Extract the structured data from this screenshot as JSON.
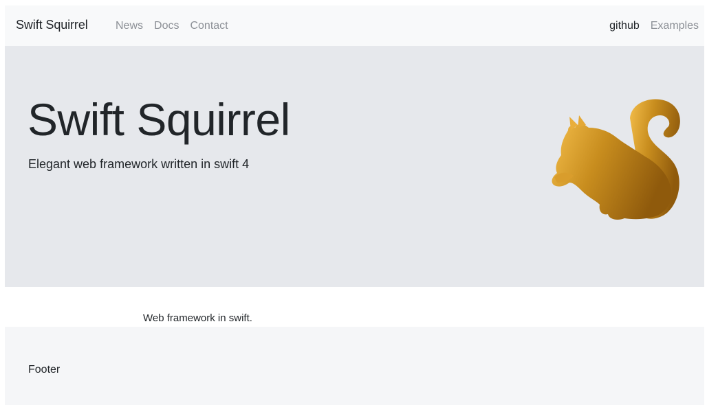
{
  "navbar": {
    "brand": "Swift Squirrel",
    "left_links": [
      {
        "label": "News",
        "active": false
      },
      {
        "label": "Docs",
        "active": false
      },
      {
        "label": "Contact",
        "active": false
      }
    ],
    "right_links": [
      {
        "label": "github",
        "active": true
      },
      {
        "label": "Examples",
        "active": false
      }
    ]
  },
  "hero": {
    "title": "Swift Squirrel",
    "lead": "Elegant web framework written in swift 4",
    "logo_icon": "squirrel-icon",
    "logo_gradient": [
      "#f3bd4a",
      "#c48a1b",
      "#9a6210"
    ]
  },
  "content": {
    "text": "Web framework in swift."
  },
  "footer": {
    "text": "Footer"
  },
  "colors": {
    "navbar_bg": "#f8f9fa",
    "jumbotron_bg": "#e6e8ec",
    "footer_bg": "#f5f6f8",
    "link_muted": "#8c9096",
    "text": "#212529"
  }
}
